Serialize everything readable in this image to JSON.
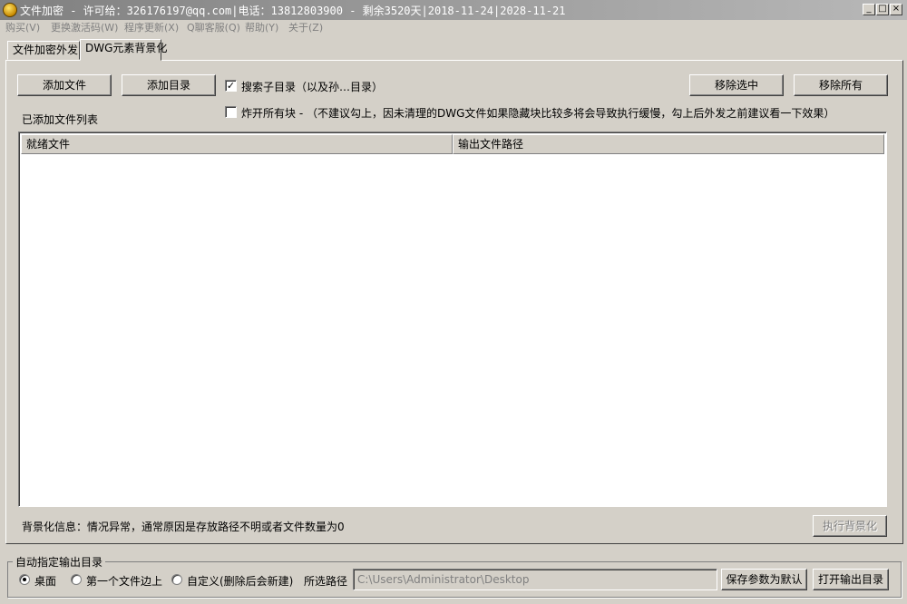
{
  "window": {
    "title": "文件加密 - 许可给：326176197@qq.com|电话：13812803900 - 剩余3520天|2018-11-24|2028-11-21",
    "controls": {
      "minimize": "_",
      "maximize": "□",
      "close": "×"
    }
  },
  "menu": [
    "购买(V)",
    "更换激活码(W)",
    "程序更新(X)",
    "Q聊客服(Q)",
    "帮助(Y)",
    "关于(Z)"
  ],
  "tabs": [
    {
      "label": "文件加密外发",
      "active": false
    },
    {
      "label": "DWG元素背景化",
      "active": true
    }
  ],
  "toolbar": {
    "add_file": "添加文件",
    "add_dir": "添加目录",
    "remove_selected": "移除选中",
    "remove_all": "移除所有"
  },
  "options": {
    "search_subdir": {
      "label": "搜索子目录（以及孙…目录）",
      "checked": true
    },
    "explode_blocks": {
      "label": "炸开所有块 -  （不建议勾上，因未清理的DWG文件如果隐藏块比较多将会导致执行缓慢，勾上后外发之前建议看一下效果）",
      "checked": false
    }
  },
  "list": {
    "caption": "已添加文件列表",
    "columns": [
      "就绪文件",
      "输出文件路径"
    ],
    "rows": []
  },
  "status": {
    "info": "背景化信息：情况异常，通常原因是存放路径不明或者文件数量为0",
    "run_button": "执行背景化"
  },
  "output": {
    "group_title": "自动指定输出目录",
    "radios": [
      {
        "label": "桌面",
        "selected": true
      },
      {
        "label": "第一个文件边上",
        "selected": false
      },
      {
        "label": "自定义(删除后会新建)",
        "selected": false
      }
    ],
    "path_label": "所选路径",
    "path_value": "C:\\Users\\Administrator\\Desktop",
    "save_button": "保存参数为默认",
    "open_button": "打开输出目录"
  }
}
